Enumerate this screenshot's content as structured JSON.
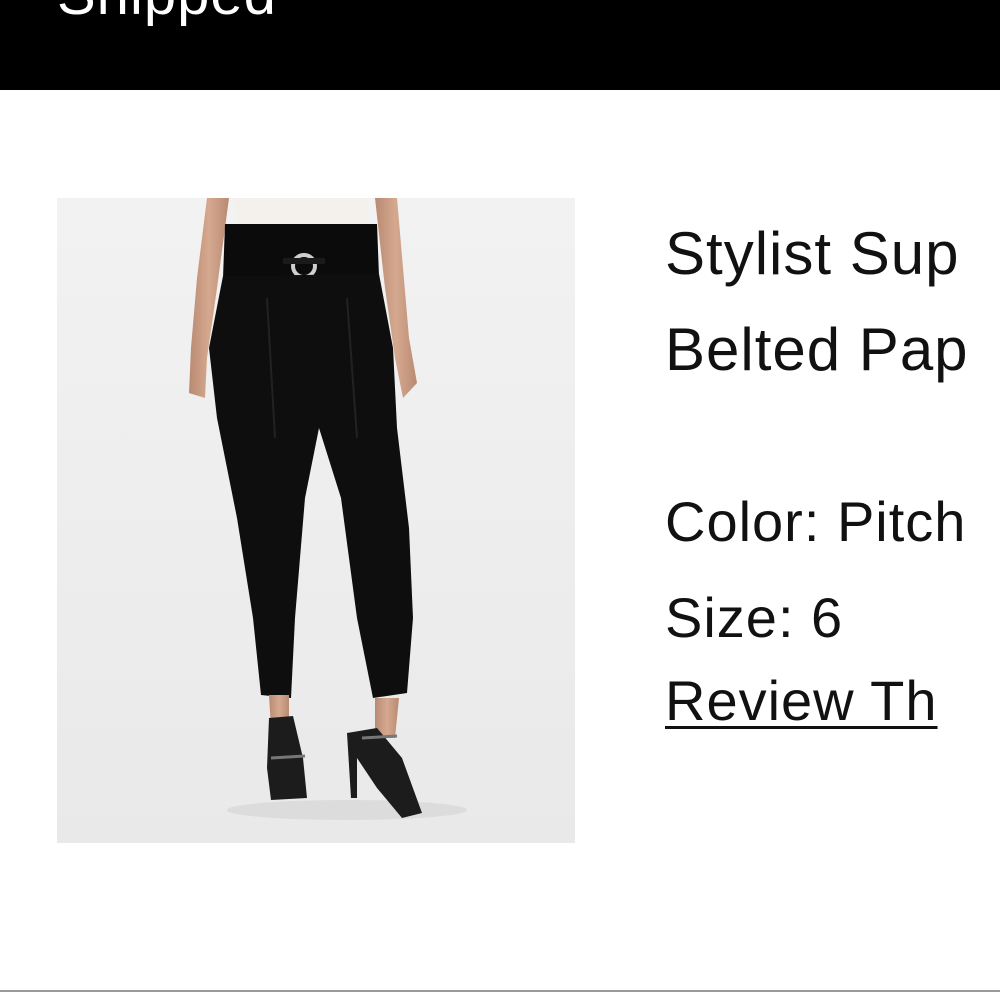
{
  "order_status": {
    "label": "Shipped"
  },
  "product": {
    "image_icon": "black-belted-paperbag-pants-photo",
    "name_line_1": "Stylist Sup",
    "name_line_2": "Belted Pap",
    "color_text": "Color: Pitch",
    "size_text": "Size: 6",
    "review_link_text": "Review Th"
  },
  "colors": {
    "status_bar_bg": "#000000",
    "status_text": "#ffffff",
    "body_text": "#111111",
    "image_bg": "#efefef",
    "divider": "#9a9a9a"
  }
}
